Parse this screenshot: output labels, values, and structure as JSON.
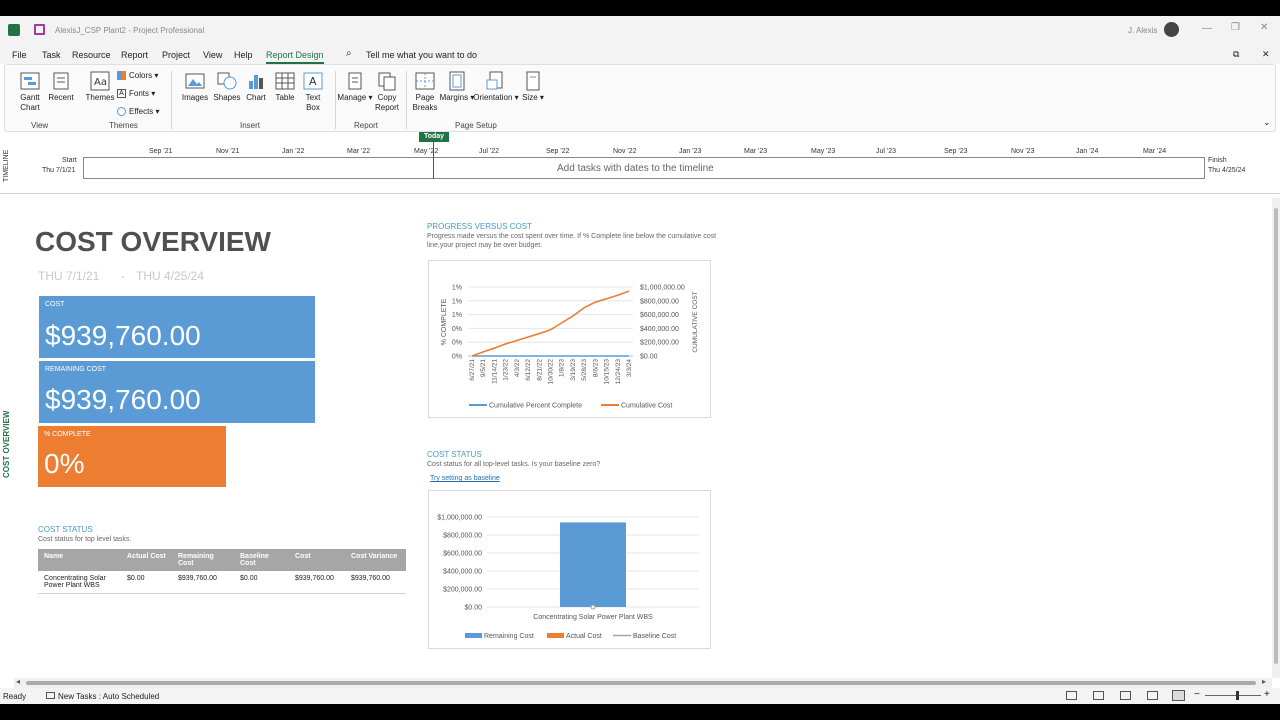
{
  "window": {
    "title": "AlexisJ_CSP Plant2  -  Project Professional",
    "user": "J. Alexis"
  },
  "menu": [
    "File",
    "Task",
    "Resource",
    "Report",
    "Project",
    "View",
    "Help",
    "Report Design"
  ],
  "tell_me": "Tell me what you want to do",
  "ribbon": {
    "gantt": "Gantt\nChart",
    "recent": "Recent",
    "themes": "Themes",
    "colors": "Colors",
    "fonts": "Fonts",
    "effects": "Effects",
    "images": "Images",
    "shapes": "Shapes",
    "chart": "Chart",
    "table": "Table",
    "textbox": "Text\nBox",
    "manage": "Manage",
    "copy_report": "Copy\nReport",
    "page_breaks": "Page\nBreaks",
    "margins": "Margins",
    "orientation": "Orientation",
    "size": "Size",
    "groups": {
      "view": "View",
      "themes": "Themes",
      "insert": "Insert",
      "report": "Report",
      "page_setup": "Page Setup"
    }
  },
  "timeline": {
    "side_label": "TIMELINE",
    "today": "Today",
    "start_label": "Start",
    "start_date": "Thu 7/1/21",
    "finish_label": "Finish",
    "finish_date": "Thu 4/25/24",
    "placeholder": "Add tasks with dates to the timeline",
    "ticks": [
      "Sep '21",
      "Nov '21",
      "Jan '22",
      "Mar '22",
      "May '22",
      "Jul '22",
      "Sep '22",
      "Nov '22",
      "Jan '23",
      "Mar '23",
      "May '23",
      "Jul '23",
      "Sep '23",
      "Nov '23",
      "Jan '24",
      "Mar '24"
    ]
  },
  "report": {
    "side_label": "COST OVERVIEW",
    "title": "COST OVERVIEW",
    "date_start": "THU 7/1/21",
    "date_dash": "-",
    "date_end": "THU 4/25/24",
    "tiles": {
      "cost_label": "COST",
      "cost_value": "$939,760.00",
      "remaining_label": "REMAINING COST",
      "remaining_value": "$939,760.00",
      "complete_label": "% COMPLETE",
      "complete_value": "0%"
    },
    "cost_status_table": {
      "heading": "COST STATUS",
      "desc": "Cost status for top level tasks.",
      "columns": [
        "Name",
        "Actual Cost",
        "Remaining Cost",
        "Baseline Cost",
        "Cost",
        "Cost Variance"
      ],
      "rows": [
        [
          "Concentrating Solar Power Plant WBS",
          "$0.00",
          "$939,760.00",
          "$0.00",
          "$939,760.00",
          "$939,760.00"
        ]
      ]
    },
    "progress": {
      "heading": "PROGRESS VERSUS COST",
      "desc": "Progress made versus the cost spent over time. If % Complete line below the cumulative cost line,your project may be over budget."
    },
    "cost_status_chart": {
      "heading": "COST STATUS",
      "desc": "Cost status for all top-level tasks. Is your baseline zero?",
      "link": "Try setting as baseline"
    }
  },
  "status": {
    "ready": "Ready",
    "new_tasks": "New Tasks : Auto Scheduled"
  },
  "colors": {
    "blue": "#5b9bd5",
    "orange": "#ed7d31",
    "green": "#217346",
    "grey": "#a6a6a6"
  },
  "chart_data": [
    {
      "type": "line",
      "title": "",
      "x": [
        "6/27/21",
        "9/5/21",
        "11/14/21",
        "1/23/22",
        "4/3/22",
        "6/12/22",
        "8/21/22",
        "10/30/22",
        "1/8/23",
        "3/19/23",
        "5/28/23",
        "8/6/23",
        "10/15/23",
        "12/24/23",
        "3/3/24"
      ],
      "series": [
        {
          "name": "Cumulative Percent Complete",
          "axis": "left",
          "values": [
            0,
            0,
            0,
            0,
            0,
            0,
            0,
            0,
            0,
            0,
            0,
            0,
            0,
            0,
            0
          ]
        },
        {
          "name": "Cumulative Cost",
          "axis": "right",
          "values": [
            0,
            60000,
            115000,
            175000,
            225000,
            275000,
            325000,
            380000,
            480000,
            580000,
            700000,
            780000,
            830000,
            880000,
            939760
          ]
        }
      ],
      "ylabel": "% COMPLETE",
      "y2label": "CUMULATIVE COST",
      "yticks": [
        "0%",
        "0%",
        "0%",
        "1%",
        "1%",
        "1%"
      ],
      "y2ticks": [
        "$0.00",
        "$200,000.00",
        "$400,000.00",
        "$600,000.00",
        "$800,000.00",
        "$1,000,000.00"
      ],
      "y2lim": [
        0,
        1000000
      ],
      "legend": "bottom"
    },
    {
      "type": "bar",
      "title": "",
      "categories": [
        "Concentrating Solar Power Plant WBS"
      ],
      "series": [
        {
          "name": "Remaining Cost",
          "values": [
            939760
          ]
        },
        {
          "name": "Actual Cost",
          "values": [
            0
          ]
        },
        {
          "name": "Baseline Cost",
          "values": [
            0
          ]
        }
      ],
      "yticks": [
        "$0.00",
        "$200,000.00",
        "$400,000.00",
        "$600,000.00",
        "$800,000.00",
        "$1,000,000.00"
      ],
      "ylim": [
        0,
        1000000
      ],
      "legend": "bottom"
    }
  ]
}
